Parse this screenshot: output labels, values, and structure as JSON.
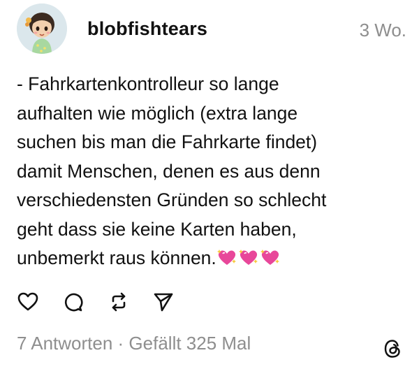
{
  "post": {
    "author": {
      "username": "blobfishtears",
      "avatar_icon": "cartoon-girl-avatar"
    },
    "timestamp": "3 Wo.",
    "body_lines": [
      "- Fahrkartenkontrolleur so lange",
      "aufhalten wie möglich (extra lange",
      "suchen bis man die Fahrkarte findet)",
      "damit Menschen, denen es aus denn",
      "verschiedensten Gründen so schlecht",
      "geht dass sie keine Karten haben,",
      "unbemerkt raus können."
    ],
    "emojis": [
      "sparkling-heart",
      "sparkling-heart",
      "sparkling-heart"
    ],
    "actions": {
      "like_icon": "heart-icon",
      "reply_icon": "comment-icon",
      "repost_icon": "repost-icon",
      "share_icon": "send-icon"
    },
    "stats": {
      "replies": "7 Antworten",
      "separator": " · ",
      "likes": "Gefällt 325 Mal"
    },
    "brand_icon": "threads-logo",
    "colors": {
      "text": "#111111",
      "muted": "#8e8e8e",
      "heart_emoji": "#e8479a"
    }
  }
}
